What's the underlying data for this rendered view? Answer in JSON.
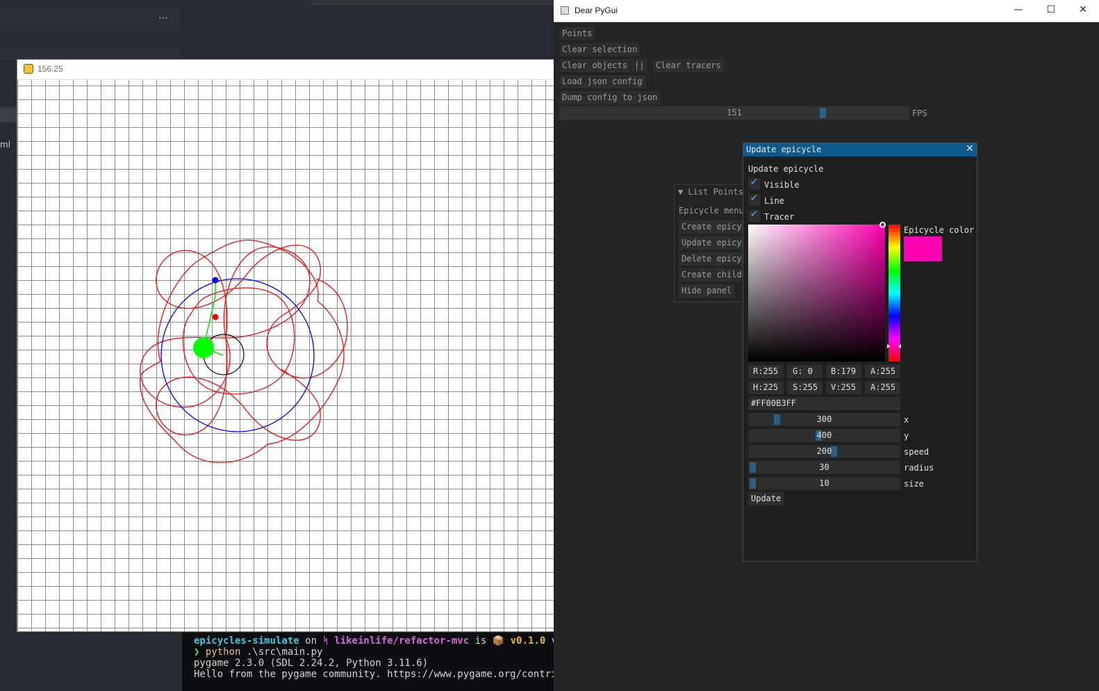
{
  "pygame_window": {
    "title": "156.25"
  },
  "terminal": {
    "line1": {
      "project": "epicycles-simulate",
      "on": " on ",
      "branch_icon": "ᛋ",
      "branch": " likeinlife/refactor-mvc",
      "is": " is ",
      "pkg_icon": "📦",
      "version": " v0.1.0",
      "via": " via"
    },
    "line2": {
      "prompt": "❯",
      "cmd": " python",
      "args": " .\\src\\main.py"
    },
    "line3": "pygame 2.3.0 (SDL 2.24.2, Python 3.11.6)",
    "line4": "Hello from the pygame community. https://www.pygame.org/contribute"
  },
  "dpg": {
    "title": "Dear PyGui",
    "window_controls": {
      "minimize": "—",
      "maximize": "☐",
      "close": "✕"
    },
    "points_label": "Points",
    "clear_selection": "Clear selection",
    "clear_objects": "Clear objects",
    "separator": "||",
    "clear_tracers": "Clear tracers",
    "load_json": "Load json config",
    "dump_json": "Dump config to json",
    "fps_value": "151",
    "fps_label": "FPS",
    "list_points": {
      "header": "List Points",
      "menu_label": "Epicycle menu",
      "buttons": [
        "Create epicycle",
        "Update epicycle",
        "Delete epicycle",
        "Create child",
        "Hide panel"
      ]
    },
    "update_window": {
      "title": "Update epicycle",
      "close": "✕",
      "heading": "Update epicycle",
      "checks": [
        {
          "label": "Visible",
          "checked": true
        },
        {
          "label": "Line",
          "checked": true
        },
        {
          "label": "Tracer",
          "checked": true
        }
      ],
      "color_label": "Epicycle color",
      "color_hex_value": "#FF00B3",
      "rgba": [
        "R:255",
        "G:  0",
        "B:179",
        "A:255"
      ],
      "hsva": [
        "H:225",
        "S:255",
        "V:255",
        "A:255"
      ],
      "hex": "#FF00B3FF",
      "sliders": [
        {
          "label": "x",
          "value": "300",
          "level": 0.17
        },
        {
          "label": "y",
          "value": "400",
          "level": 0.46
        },
        {
          "label": "speed",
          "value": "200",
          "level": 0.57
        },
        {
          "label": "radius",
          "value": "30",
          "level": 0.0
        },
        {
          "label": "size",
          "value": "10",
          "level": 0.0
        }
      ],
      "update_button": "Update"
    }
  },
  "colors": {
    "accent": "#2d5f86",
    "title_active": "#0e5a8c",
    "epicycle_blue": "#0000ff",
    "epicycle_red": "#e81010",
    "center_green": "#00ff00"
  }
}
